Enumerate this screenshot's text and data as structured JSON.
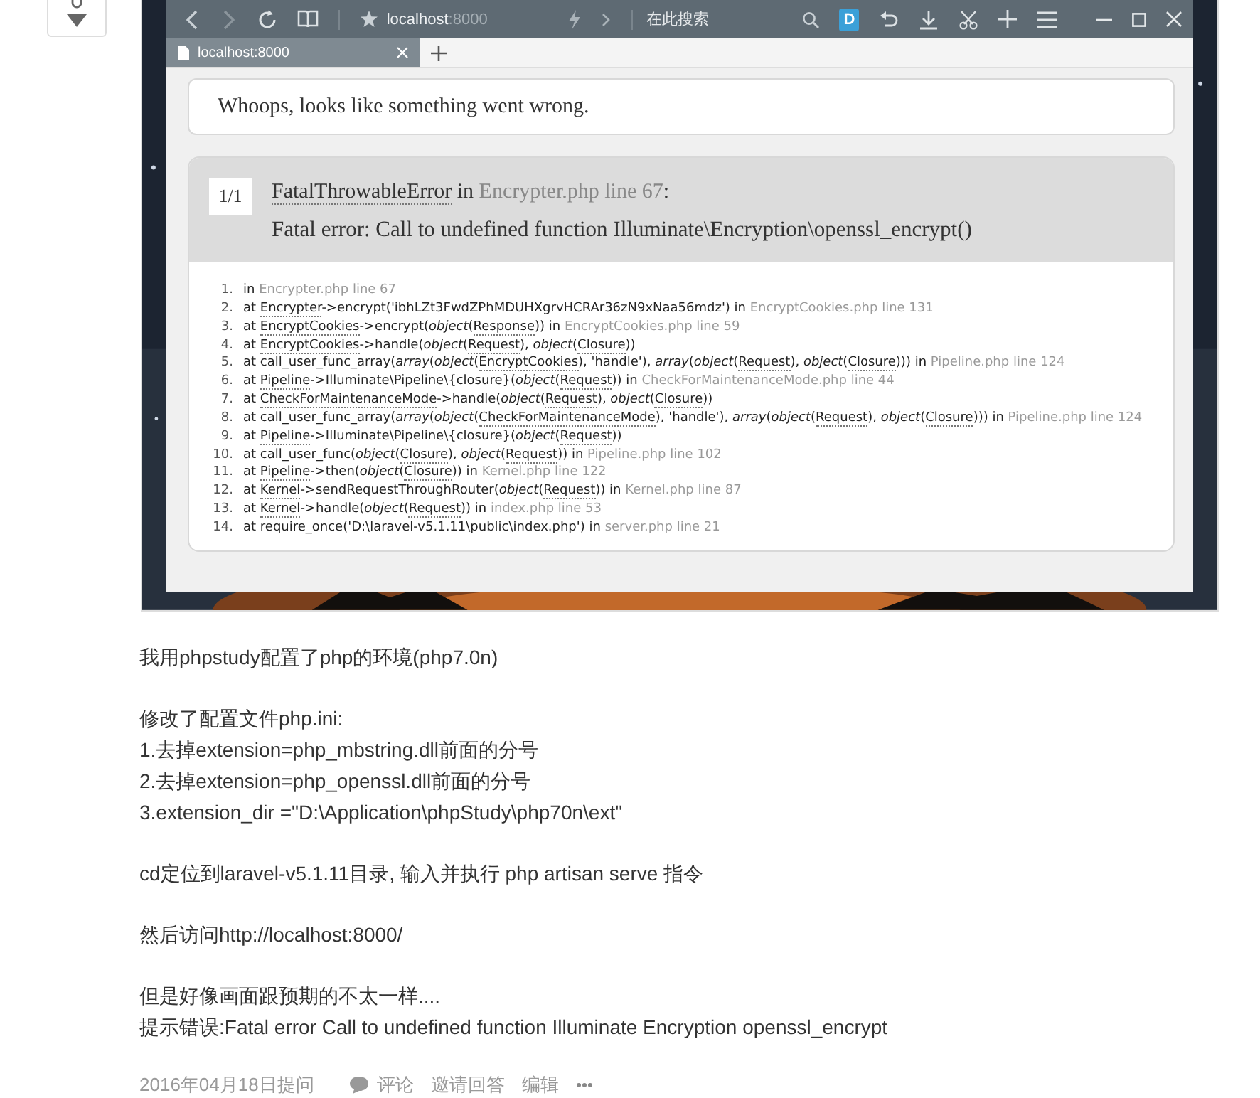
{
  "browser": {
    "address": {
      "host": "localhost",
      "port": ":8000"
    },
    "search_placeholder": "在此搜索",
    "extension_badge": "D",
    "tabs": [
      {
        "label": "localhost:8000",
        "selected": true
      }
    ]
  },
  "error_page": {
    "message": "Whoops, looks like something went wrong.",
    "count": "1/1",
    "title": [
      {
        "kind": "class",
        "t": "FatalThrowableError"
      },
      {
        "kind": "text",
        "t": " in "
      },
      {
        "kind": "file",
        "t": "Encrypter.php line 67"
      },
      {
        "kind": "text",
        "t": ":"
      }
    ],
    "detail": "Fatal error: Call to undefined function Illuminate\\Encryption\\openssl_encrypt()",
    "trace": [
      {
        "n": "1.",
        "parts": [
          {
            "kind": "text",
            "t": "in "
          },
          {
            "kind": "file",
            "t": "Encrypter.php line 67"
          }
        ]
      },
      {
        "n": "2.",
        "parts": [
          {
            "kind": "text",
            "t": "at "
          },
          {
            "kind": "class",
            "t": "Encrypter"
          },
          {
            "kind": "text",
            "t": "->encrypt('ibhLZt3FwdZPhMDUHXgrvHCRAr36zN9xNaa56mdz') in "
          },
          {
            "kind": "file",
            "t": "EncryptCookies.php line 131"
          }
        ]
      },
      {
        "n": "3.",
        "parts": [
          {
            "kind": "text",
            "t": "at "
          },
          {
            "kind": "class",
            "t": "EncryptCookies"
          },
          {
            "kind": "text",
            "t": "->encrypt("
          },
          {
            "kind": "type",
            "t": "object"
          },
          {
            "kind": "text",
            "t": "("
          },
          {
            "kind": "class",
            "t": "Response"
          },
          {
            "kind": "text",
            "t": ")) in "
          },
          {
            "kind": "file",
            "t": "EncryptCookies.php line 59"
          }
        ]
      },
      {
        "n": "4.",
        "parts": [
          {
            "kind": "text",
            "t": "at "
          },
          {
            "kind": "class",
            "t": "EncryptCookies"
          },
          {
            "kind": "text",
            "t": "->handle("
          },
          {
            "kind": "type",
            "t": "object"
          },
          {
            "kind": "text",
            "t": "("
          },
          {
            "kind": "class",
            "t": "Request"
          },
          {
            "kind": "text",
            "t": "), "
          },
          {
            "kind": "type",
            "t": "object"
          },
          {
            "kind": "text",
            "t": "("
          },
          {
            "kind": "class",
            "t": "Closure"
          },
          {
            "kind": "text",
            "t": "))"
          }
        ]
      },
      {
        "n": "5.",
        "parts": [
          {
            "kind": "text",
            "t": "at call_user_func_array("
          },
          {
            "kind": "type",
            "t": "array"
          },
          {
            "kind": "text",
            "t": "("
          },
          {
            "kind": "type",
            "t": "object"
          },
          {
            "kind": "text",
            "t": "("
          },
          {
            "kind": "class",
            "t": "EncryptCookies"
          },
          {
            "kind": "text",
            "t": "), 'handle'), "
          },
          {
            "kind": "type",
            "t": "array"
          },
          {
            "kind": "text",
            "t": "("
          },
          {
            "kind": "type",
            "t": "object"
          },
          {
            "kind": "text",
            "t": "("
          },
          {
            "kind": "class",
            "t": "Request"
          },
          {
            "kind": "text",
            "t": "), "
          },
          {
            "kind": "type",
            "t": "object"
          },
          {
            "kind": "text",
            "t": "("
          },
          {
            "kind": "class",
            "t": "Closure"
          },
          {
            "kind": "text",
            "t": "))) in "
          },
          {
            "kind": "file",
            "t": "Pipeline.php line 124"
          }
        ]
      },
      {
        "n": "6.",
        "parts": [
          {
            "kind": "text",
            "t": "at "
          },
          {
            "kind": "class",
            "t": "Pipeline"
          },
          {
            "kind": "text",
            "t": "->Illuminate\\Pipeline\\{closure}("
          },
          {
            "kind": "type",
            "t": "object"
          },
          {
            "kind": "text",
            "t": "("
          },
          {
            "kind": "class",
            "t": "Request"
          },
          {
            "kind": "text",
            "t": ")) in "
          },
          {
            "kind": "file",
            "t": "CheckForMaintenanceMode.php line 44"
          }
        ]
      },
      {
        "n": "7.",
        "parts": [
          {
            "kind": "text",
            "t": "at "
          },
          {
            "kind": "class",
            "t": "CheckForMaintenanceMode"
          },
          {
            "kind": "text",
            "t": "->handle("
          },
          {
            "kind": "type",
            "t": "object"
          },
          {
            "kind": "text",
            "t": "("
          },
          {
            "kind": "class",
            "t": "Request"
          },
          {
            "kind": "text",
            "t": "), "
          },
          {
            "kind": "type",
            "t": "object"
          },
          {
            "kind": "text",
            "t": "("
          },
          {
            "kind": "class",
            "t": "Closure"
          },
          {
            "kind": "text",
            "t": "))"
          }
        ]
      },
      {
        "n": "8.",
        "parts": [
          {
            "kind": "text",
            "t": "at call_user_func_array("
          },
          {
            "kind": "type",
            "t": "array"
          },
          {
            "kind": "text",
            "t": "("
          },
          {
            "kind": "type",
            "t": "object"
          },
          {
            "kind": "text",
            "t": "("
          },
          {
            "kind": "class",
            "t": "CheckForMaintenanceMode"
          },
          {
            "kind": "text",
            "t": "), 'handle'), "
          },
          {
            "kind": "type",
            "t": "array"
          },
          {
            "kind": "text",
            "t": "("
          },
          {
            "kind": "type",
            "t": "object"
          },
          {
            "kind": "text",
            "t": "("
          },
          {
            "kind": "class",
            "t": "Request"
          },
          {
            "kind": "text",
            "t": "), "
          },
          {
            "kind": "type",
            "t": "object"
          },
          {
            "kind": "text",
            "t": "("
          },
          {
            "kind": "class",
            "t": "Closure"
          },
          {
            "kind": "text",
            "t": "))) in "
          },
          {
            "kind": "file",
            "t": "Pipeline.php line 124"
          }
        ]
      },
      {
        "n": "9.",
        "parts": [
          {
            "kind": "text",
            "t": "at "
          },
          {
            "kind": "class",
            "t": "Pipeline"
          },
          {
            "kind": "text",
            "t": "->Illuminate\\Pipeline\\{closure}("
          },
          {
            "kind": "type",
            "t": "object"
          },
          {
            "kind": "text",
            "t": "("
          },
          {
            "kind": "class",
            "t": "Request"
          },
          {
            "kind": "text",
            "t": "))"
          }
        ]
      },
      {
        "n": "10.",
        "parts": [
          {
            "kind": "text",
            "t": "at call_user_func("
          },
          {
            "kind": "type",
            "t": "object"
          },
          {
            "kind": "text",
            "t": "("
          },
          {
            "kind": "class",
            "t": "Closure"
          },
          {
            "kind": "text",
            "t": "), "
          },
          {
            "kind": "type",
            "t": "object"
          },
          {
            "kind": "text",
            "t": "("
          },
          {
            "kind": "class",
            "t": "Request"
          },
          {
            "kind": "text",
            "t": ")) in "
          },
          {
            "kind": "file",
            "t": "Pipeline.php line 102"
          }
        ]
      },
      {
        "n": "11.",
        "parts": [
          {
            "kind": "text",
            "t": "at "
          },
          {
            "kind": "class",
            "t": "Pipeline"
          },
          {
            "kind": "text",
            "t": "->then("
          },
          {
            "kind": "type",
            "t": "object"
          },
          {
            "kind": "text",
            "t": "("
          },
          {
            "kind": "class",
            "t": "Closure"
          },
          {
            "kind": "text",
            "t": ")) in "
          },
          {
            "kind": "file",
            "t": "Kernel.php line 122"
          }
        ]
      },
      {
        "n": "12.",
        "parts": [
          {
            "kind": "text",
            "t": "at "
          },
          {
            "kind": "class",
            "t": "Kernel"
          },
          {
            "kind": "text",
            "t": "->sendRequestThroughRouter("
          },
          {
            "kind": "type",
            "t": "object"
          },
          {
            "kind": "text",
            "t": "("
          },
          {
            "kind": "class",
            "t": "Request"
          },
          {
            "kind": "text",
            "t": ")) in "
          },
          {
            "kind": "file",
            "t": "Kernel.php line 87"
          }
        ]
      },
      {
        "n": "13.",
        "parts": [
          {
            "kind": "text",
            "t": "at "
          },
          {
            "kind": "class",
            "t": "Kernel"
          },
          {
            "kind": "text",
            "t": "->handle("
          },
          {
            "kind": "type",
            "t": "object"
          },
          {
            "kind": "text",
            "t": "("
          },
          {
            "kind": "class",
            "t": "Request"
          },
          {
            "kind": "text",
            "t": ")) in "
          },
          {
            "kind": "file",
            "t": "index.php line 53"
          }
        ]
      },
      {
        "n": "14.",
        "parts": [
          {
            "kind": "text",
            "t": "at require_once('D:\\laravel-v5.1.11\\public\\index.php') in "
          },
          {
            "kind": "file",
            "t": "server.php line 21"
          }
        ]
      }
    ]
  },
  "question": {
    "paragraphs": [
      [
        "我用phpstudy配置了php的环境(php7.0n)"
      ],
      [
        "修改了配置文件php.ini:",
        "1.去掉extension=php_mbstring.dll前面的分号",
        "2.去掉extension=php_openssl.dll前面的分号",
        "3.extension_dir =\"D:\\Application\\phpStudy\\php70n\\ext\""
      ],
      [
        "cd定位到laravel-v5.1.11目录, 输入并执行 php artisan serve 指令"
      ],
      [
        "然后访问http://localhost:8000/"
      ],
      [
        "但是好像画面跟预期的不太一样....",
        "提示错误:Fatal error Call to undefined function Illuminate Encryption openssl_encrypt"
      ]
    ]
  },
  "meta": {
    "date": "2016年04月18日提问",
    "comment": "评论",
    "invite": "邀请回答",
    "edit": "编辑"
  }
}
